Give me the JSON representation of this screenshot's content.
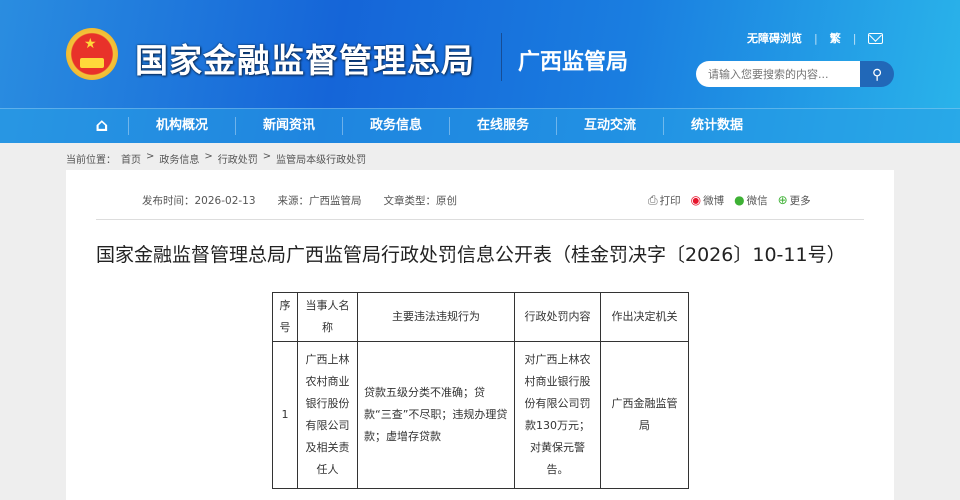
{
  "header": {
    "org_name": "国家金融监督管理总局",
    "branch_name": "广西监管局",
    "accessibility": "无障碍浏览",
    "traditional": "繁",
    "search_placeholder": "请输入您要搜索的内容..."
  },
  "nav": {
    "items": [
      "机构概况",
      "新闻资讯",
      "政务信息",
      "在线服务",
      "互动交流",
      "统计数据"
    ]
  },
  "breadcrumb": {
    "label": "当前位置：",
    "items": [
      "首页",
      "政务信息",
      "行政处罚",
      "监管局本级行政处罚"
    ],
    "sep": ">"
  },
  "meta": {
    "publish": "发布时间：2026-02-13",
    "source": "来源：广西监管局",
    "type": "文章类型：原创"
  },
  "share": {
    "print": "打印",
    "weibo": "微博",
    "wechat": "微信",
    "more": "更多"
  },
  "article": {
    "title": "国家金融监督管理总局广西监管局行政处罚信息公开表（桂金罚决字〔2026〕10-11号）"
  },
  "table": {
    "headers": [
      "序号",
      "当事人名称",
      "主要违法违规行为",
      "行政处罚内容",
      "作出决定机关"
    ],
    "rows": [
      [
        "1",
        "广西上林农村商业银行股份有限公司及相关责任人",
        "贷款五级分类不准确；贷款“三查”不尽职；违规办理贷款；虚增存贷款",
        "对广西上林农村商业银行股份有限公司罚款130万元；对黄保元警告。",
        "广西金融监管局"
      ]
    ]
  }
}
